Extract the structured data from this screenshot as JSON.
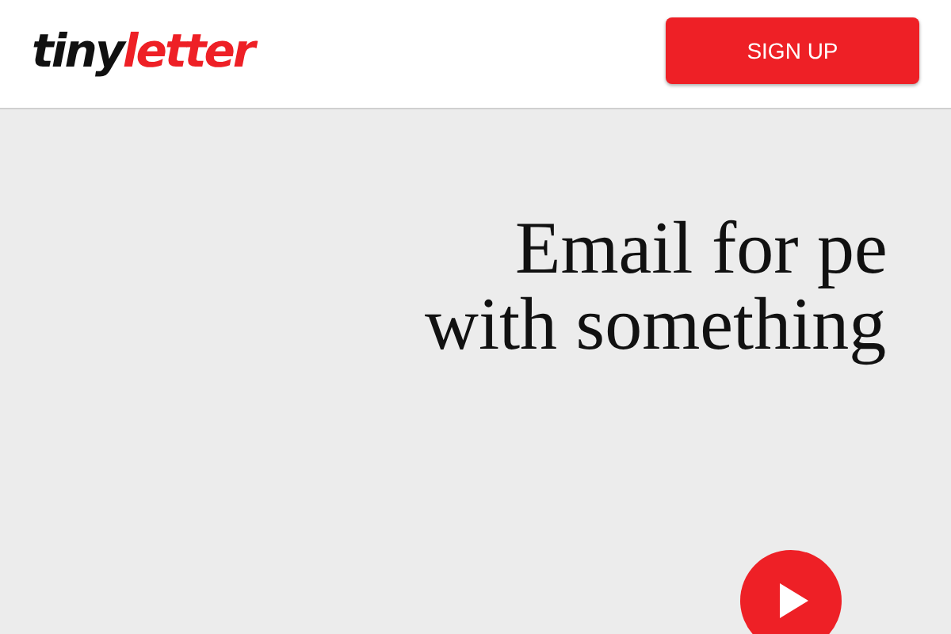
{
  "header": {
    "logo": {
      "part_1": "tiny",
      "part_2": "letter"
    },
    "signup_button": "SIGN UP"
  },
  "hero": {
    "headline_lines": [
      "Email for pe",
      "with something"
    ]
  }
}
